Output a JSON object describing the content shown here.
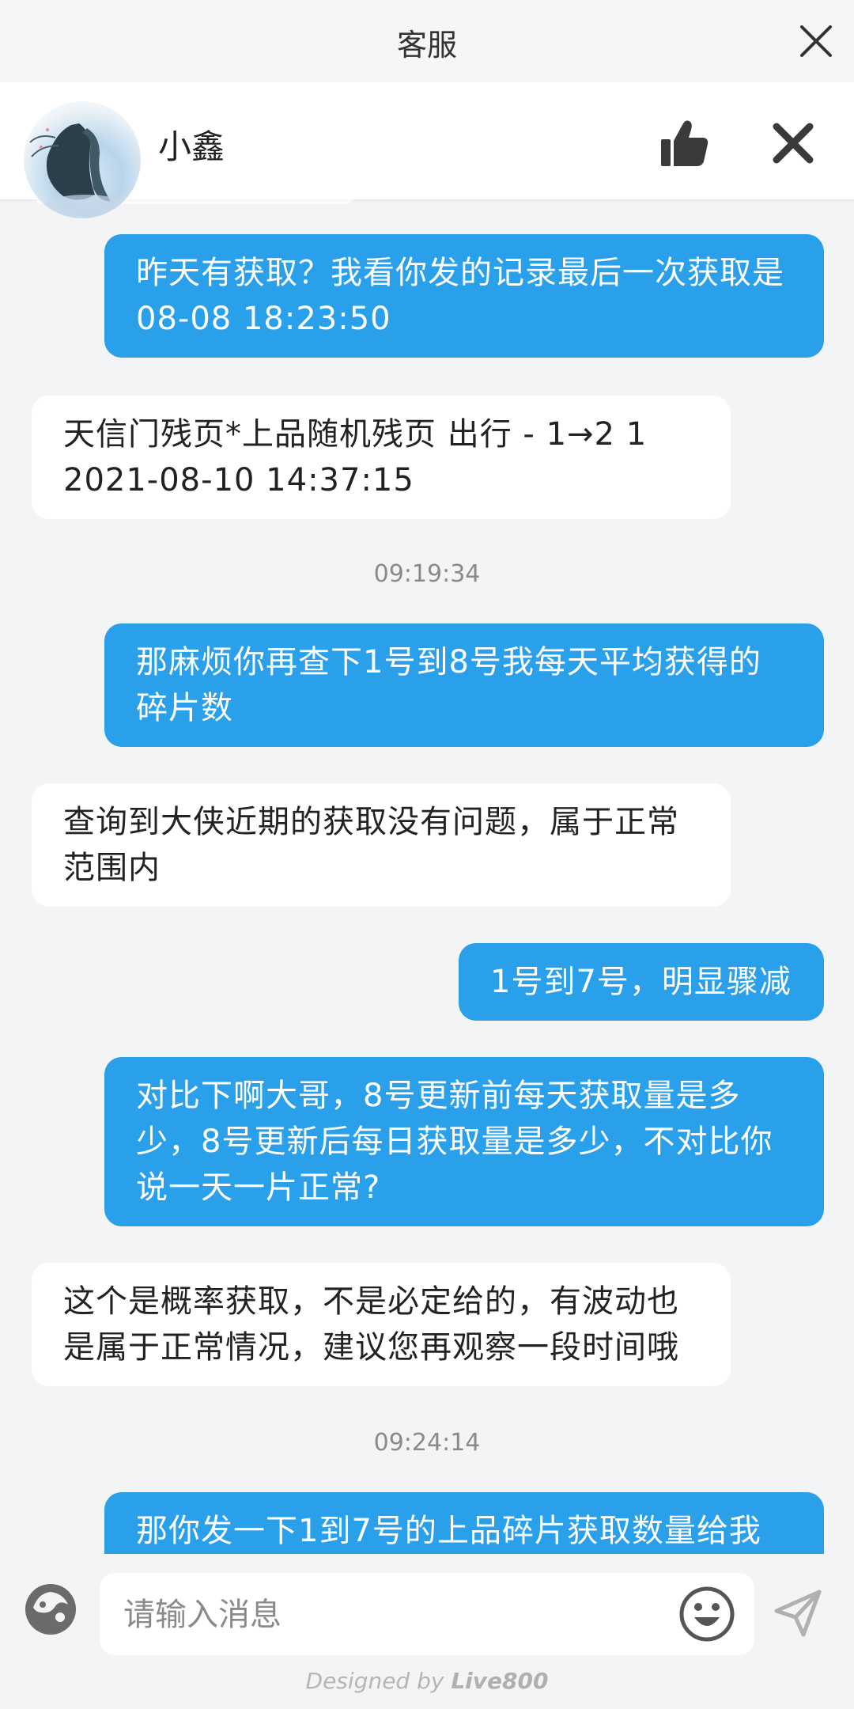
{
  "topbar": {
    "title": "客服"
  },
  "agent": {
    "name": "小鑫"
  },
  "messages": [
    {
      "text": "昨天有获取？我看你发的记录最后一次获取是08-08 18:23:50"
    },
    {
      "text": "天信门残页*上品随机残页 出行 - 1→2 1\n2021-08-10 14:37:15"
    },
    {
      "text": "09:19:34"
    },
    {
      "text": "那麻烦你再查下1号到8号我每天平均获得的碎片数"
    },
    {
      "text": "查询到大侠近期的获取没有问题，属于正常范围内"
    },
    {
      "text": "1号到7号，明显骤减"
    },
    {
      "text": "对比下啊大哥，8号更新前每天获取量是多少，8号更新后每日获取量是多少，不对比你说一天一片正常?"
    },
    {
      "text": "这个是概率获取，不是必定给的，有波动也是属于正常情况，建议您再观察一段时间哦"
    },
    {
      "text": "09:24:14"
    },
    {
      "text": "那你发一下1到7号的上品碎片获取数量给我"
    }
  ],
  "input": {
    "placeholder": "请输入消息",
    "value": ""
  },
  "footer": {
    "designed_by": "Designed by",
    "brand": "Live800"
  },
  "colors": {
    "outgoing_bubble": "#2aa0ea",
    "incoming_bubble": "#ffffff",
    "background": "#f3f4f6"
  }
}
